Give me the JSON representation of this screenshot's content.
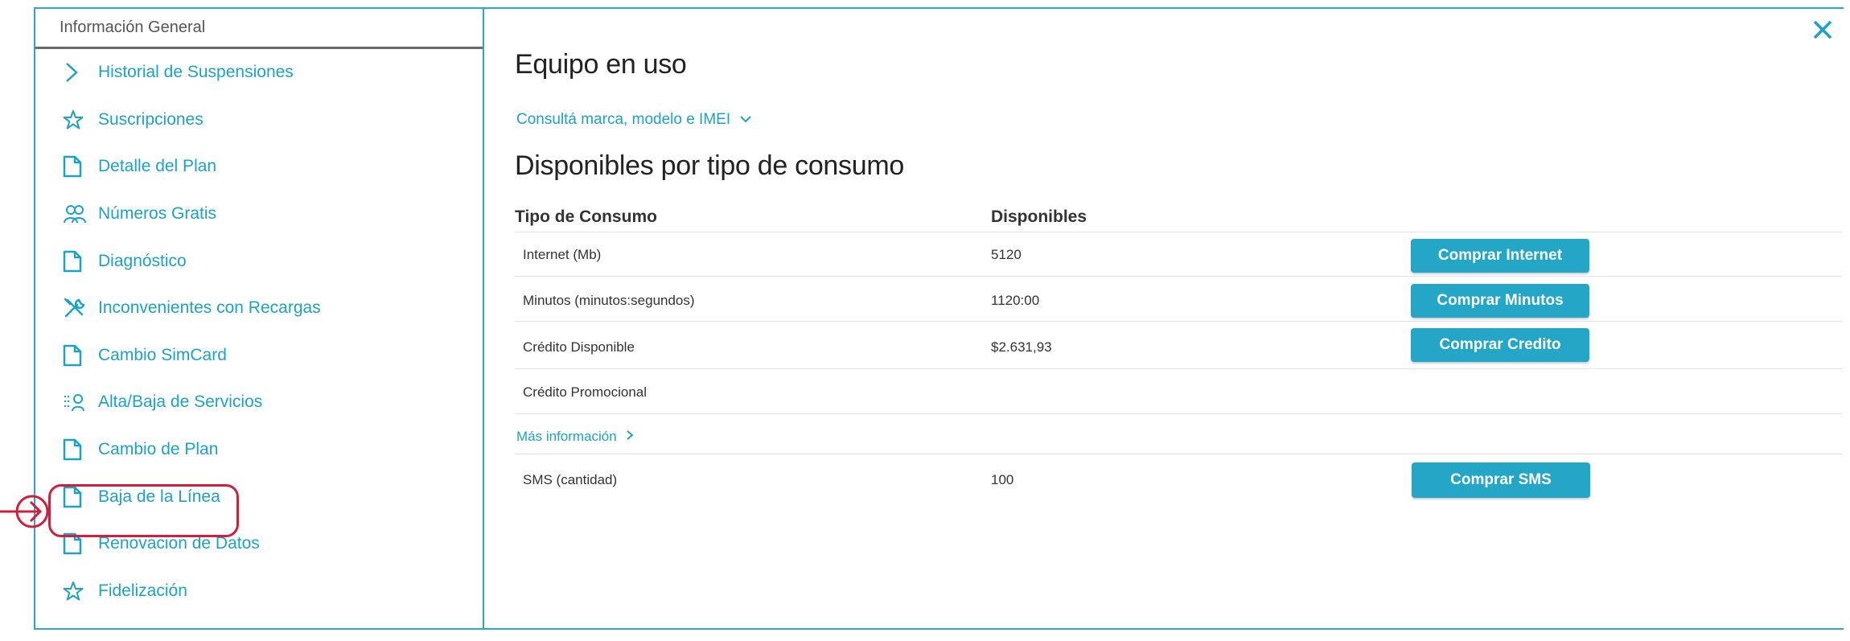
{
  "sidebar": {
    "header": "Información General",
    "items": [
      {
        "label": "Historial de Suspensiones",
        "icon": "chevron-right-icon"
      },
      {
        "label": "Suscripciones",
        "icon": "star-icon"
      },
      {
        "label": "Detalle del Plan",
        "icon": "document-icon"
      },
      {
        "label": "Números Gratis",
        "icon": "users-icon"
      },
      {
        "label": "Diagnóstico",
        "icon": "document-icon"
      },
      {
        "label": "Inconvenientes con Recargas",
        "icon": "tools-icon"
      },
      {
        "label": "Cambio SimCard",
        "icon": "document-icon"
      },
      {
        "label": "Alta/Baja de Servicios",
        "icon": "services-icon"
      },
      {
        "label": "Cambio de Plan",
        "icon": "document-icon"
      },
      {
        "label": "Baja de la Línea",
        "icon": "document-icon"
      },
      {
        "label": "Renovacion de Datos",
        "icon": "document-icon"
      },
      {
        "label": "Fidelización",
        "icon": "star-icon"
      }
    ]
  },
  "main": {
    "title_device": "Equipo en uso",
    "device_link": "Consultá marca, modelo e IMEI",
    "title_consumption": "Disponibles por tipo de consumo",
    "table": {
      "headers": [
        "Tipo de Consumo",
        "Disponibles"
      ],
      "rows": [
        {
          "type": "Internet (Mb)",
          "value": "5120",
          "button": "Comprar Internet"
        },
        {
          "type": "Minutos (minutos:segundos)",
          "value": "1120:00",
          "button": "Comprar Minutos"
        },
        {
          "type": "Crédito Disponible",
          "value": "$2.631,93",
          "button": "Comprar Credito"
        },
        {
          "type": "Crédito Promocional",
          "value": "",
          "button": ""
        }
      ],
      "more_info": "Más información",
      "sms_row": {
        "type": "SMS (cantidad)",
        "value": "100",
        "button": "Comprar SMS"
      }
    }
  },
  "colors": {
    "accent": "#24a6c6",
    "highlight": "#d21d3c",
    "border": "#29a8c9"
  }
}
